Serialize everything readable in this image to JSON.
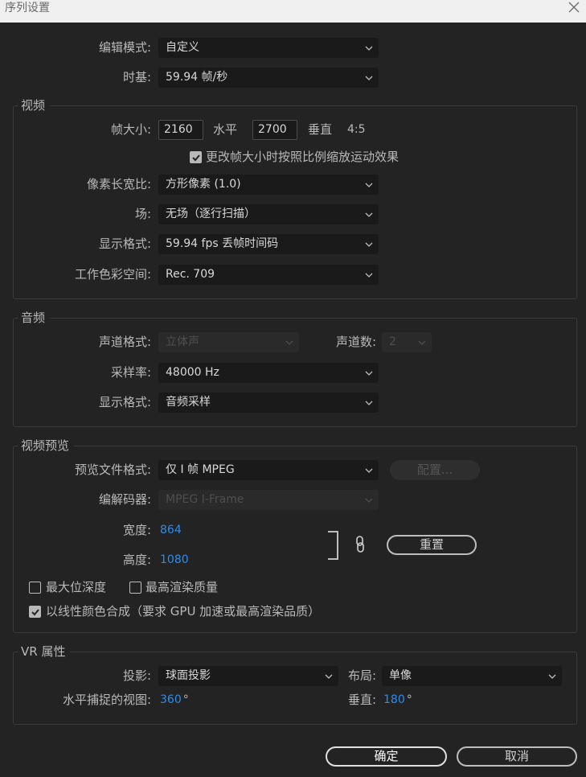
{
  "window": {
    "title": "序列设置"
  },
  "general": {
    "edit_mode": {
      "label": "编辑模式:",
      "value": "自定义"
    },
    "timebase": {
      "label": "时基:",
      "value": "59.94  帧/秒"
    }
  },
  "video": {
    "section_title": "视频",
    "frame_size_label": "帧大小:",
    "horizontal_value": "2160",
    "horizontal_label": "水平",
    "vertical_value": "2700",
    "vertical_label": "垂直",
    "aspect": "4:5",
    "scale_checkbox_label": "更改帧大小时按照比例缩放运动效果",
    "scale_checked": true,
    "pixel_aspect": {
      "label": "像素长宽比:",
      "value": "方形像素 (1.0)"
    },
    "fields": {
      "label": "场:",
      "value": "无场（逐行扫描）"
    },
    "display_format": {
      "label": "显示格式:",
      "value": "59.94 fps 丢帧时间码"
    },
    "color_space": {
      "label": "工作色彩空间:",
      "value": "Rec. 709"
    }
  },
  "audio": {
    "section_title": "音频",
    "channel_format": {
      "label": "声道格式:",
      "value": "立体声"
    },
    "channel_count": {
      "label": "声道数:",
      "value": "2"
    },
    "sample_rate": {
      "label": "采样率:",
      "value": "48000 Hz"
    },
    "display_format": {
      "label": "显示格式:",
      "value": "音频采样"
    }
  },
  "preview": {
    "section_title": "视频预览",
    "file_format": {
      "label": "预览文件格式:",
      "value": "仅 I 帧 MPEG"
    },
    "configure_label": "配置...",
    "codec": {
      "label": "编解码器:",
      "value": "MPEG I-Frame"
    },
    "width": {
      "label": "宽度:",
      "value": "864"
    },
    "height": {
      "label": "高度:",
      "value": "1080"
    },
    "reset_label": "重置",
    "max_bit_depth": {
      "label": "最大位深度",
      "checked": false
    },
    "max_render_quality": {
      "label": "最高渲染质量",
      "checked": false
    },
    "linear_color": {
      "label": "以线性颜色合成（要求 GPU 加速或最高渲染品质）",
      "checked": true
    }
  },
  "vr": {
    "section_title": "VR 属性",
    "projection": {
      "label": "投影:",
      "value": "球面投影"
    },
    "layout": {
      "label": "布局:",
      "value": "单像"
    },
    "h_view": {
      "label": "水平捕捉的视图:",
      "value": "360",
      "unit": "°"
    },
    "v_view": {
      "label": "垂直:",
      "value": "180",
      "unit": "°"
    }
  },
  "buttons": {
    "ok": "确定",
    "cancel": "取消"
  },
  "icons": {
    "close": "close-icon",
    "chevron": "chevron-down-icon",
    "link": "link-icon",
    "check": "check-icon"
  }
}
